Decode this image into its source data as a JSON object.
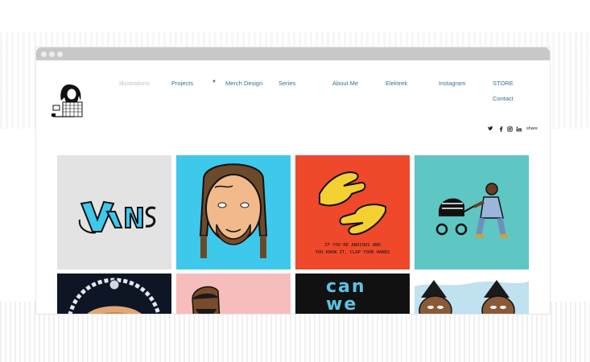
{
  "nav": {
    "items": [
      {
        "label": "Illustrations",
        "active": true
      },
      {
        "label": "Projects",
        "active": false
      },
      {
        "label": "Merch Design",
        "active": false
      },
      {
        "label": "Series",
        "active": false
      },
      {
        "label": "About Me",
        "active": false
      },
      {
        "label": "Elektrek",
        "active": false
      },
      {
        "label": "Instagram",
        "active": false
      },
      {
        "label": "STORE",
        "active": false
      },
      {
        "label": "Contact",
        "active": false
      }
    ],
    "dropdown_icon": "caret-down-icon"
  },
  "social": {
    "icons": [
      "twitter-icon",
      "facebook-icon",
      "instagram-icon",
      "linkedin-icon"
    ],
    "share_label": "share"
  },
  "gallery": {
    "tile3_text_line1": "IF YOU'RE ANXIOUS AND",
    "tile3_text_line2": "YOU KNOW IT, CLAP YOUR HANDS",
    "tile7_text": "can we go"
  },
  "colors": {
    "nav_link": "#3a6f93",
    "tile_post": "#3ec8ec",
    "tile_hands": "#f0482a",
    "tile_teal": "#5ec6c3",
    "tile_pink": "#f7bdbd"
  }
}
